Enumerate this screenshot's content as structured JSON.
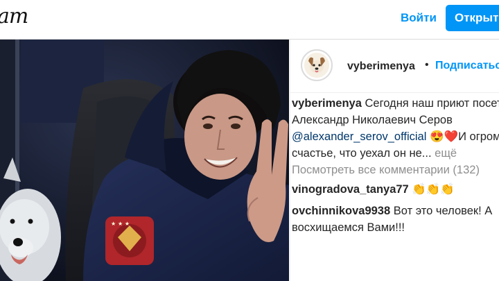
{
  "header": {
    "logo_text": "am",
    "login_label": "Войти",
    "open_label": "Открыть",
    "accent_color": "#0095f6"
  },
  "post": {
    "username": "vyberimenya",
    "dot": "•",
    "follow_label": "Подписаться",
    "caption": {
      "username": "vyberimenya",
      "line1": "Сегодня наш приют посетил",
      "line2": "Александр Николаевич Серов",
      "mention": "@alexander_serov_official",
      "emoji": "😍❤️",
      "line3_rest": "И огромное",
      "line4": "счастье, что уехал он не...",
      "more_label": "ещё"
    },
    "view_all_comments": "Посмотреть все комментарии (132)",
    "comments": [
      {
        "username": "vinogradova_tanya77",
        "text": "👏👏👏"
      },
      {
        "username": "ovchinnikova9938",
        "text_line1": "Вот это человек! А",
        "text_line2": "восхищаемся Вами!!!"
      }
    ]
  }
}
